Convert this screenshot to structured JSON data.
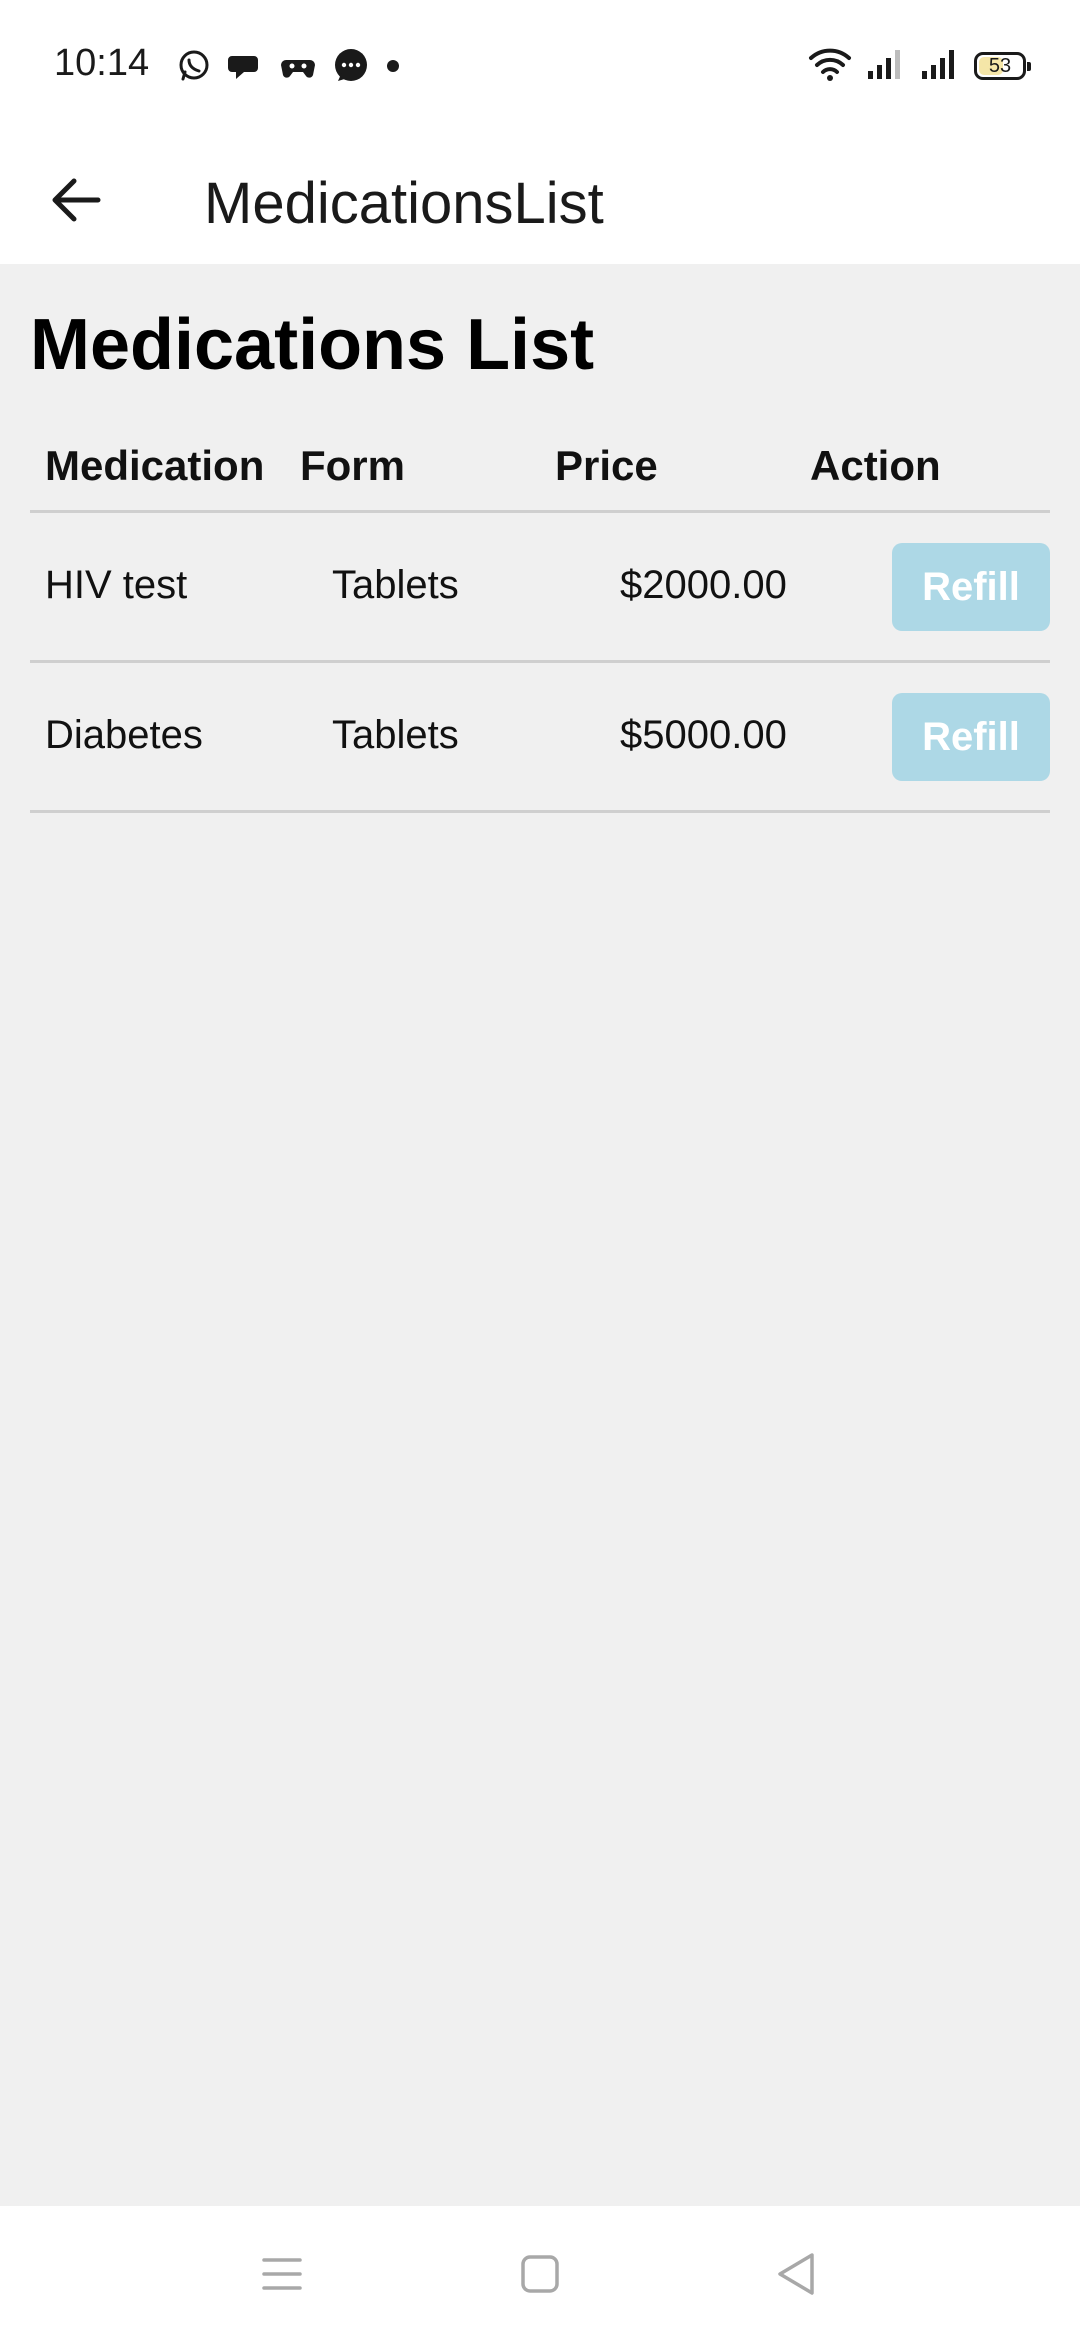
{
  "status_bar": {
    "time": "10:14",
    "notification_icons": [
      "whatsapp-icon",
      "chat-bubble-icon",
      "game-controller-icon",
      "messenger-icon",
      "dot-icon"
    ],
    "right_icons": [
      "wifi-icon",
      "signal-icon",
      "signal-icon"
    ],
    "battery_level": "53"
  },
  "app_bar": {
    "back_icon": "arrow-left-icon",
    "title": "MedicationsList"
  },
  "page": {
    "heading": "Medications List"
  },
  "table": {
    "headers": {
      "medication": "Medication",
      "form": "Form",
      "price": "Price",
      "action": "Action"
    },
    "rows": [
      {
        "medication": "HIV test",
        "form": "Tablets",
        "price": "$2000.00",
        "action_label": "Refill"
      },
      {
        "medication": "Diabetes",
        "form": "Tablets",
        "price": "$5000.00",
        "action_label": "Refill"
      }
    ]
  },
  "nav_bar": {
    "icons": [
      "menu-icon",
      "home-square-icon",
      "back-triangle-icon"
    ]
  },
  "colors": {
    "refill_button_bg": "#add8e6",
    "refill_button_text": "#ffffff",
    "content_bg": "#f0f0f0",
    "bar_bg": "#ffffff",
    "divider": "#cfcfcf"
  }
}
